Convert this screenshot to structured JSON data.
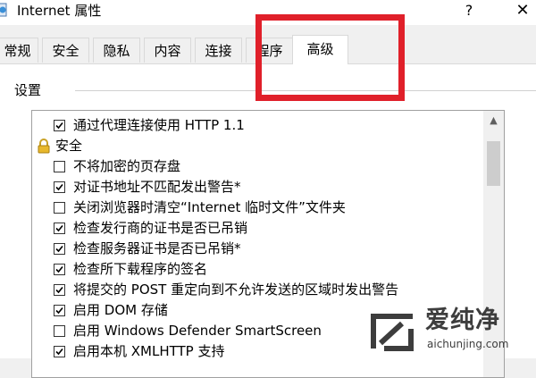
{
  "window": {
    "title": "Internet 属性",
    "help_glyph": "?",
    "close_glyph": "✕",
    "icon": "internet-options-icon"
  },
  "tabs": [
    {
      "label": "常规",
      "active": false
    },
    {
      "label": "安全",
      "active": false
    },
    {
      "label": "隐私",
      "active": false
    },
    {
      "label": "内容",
      "active": false
    },
    {
      "label": "连接",
      "active": false
    },
    {
      "label": "程序",
      "active": false
    },
    {
      "label": "高级",
      "active": true
    }
  ],
  "settings": {
    "group_label": "设置",
    "items": [
      {
        "kind": "checkbox",
        "checked": true,
        "label": "通过代理连接使用 HTTP 1.1"
      },
      {
        "kind": "category",
        "icon": "lock-icon",
        "label": "安全"
      },
      {
        "kind": "checkbox",
        "checked": false,
        "label": "不将加密的页存盘"
      },
      {
        "kind": "checkbox",
        "checked": true,
        "label": "对证书地址不匹配发出警告*"
      },
      {
        "kind": "checkbox",
        "checked": false,
        "label": "关闭浏览器时清空“Internet 临时文件”文件夹"
      },
      {
        "kind": "checkbox",
        "checked": true,
        "label": "检查发行商的证书是否已吊销"
      },
      {
        "kind": "checkbox",
        "checked": true,
        "label": "检查服务器证书是否已吊销*"
      },
      {
        "kind": "checkbox",
        "checked": true,
        "label": "检查所下载程序的签名"
      },
      {
        "kind": "checkbox",
        "checked": true,
        "label": "将提交的 POST 重定向到不允许发送的区域时发出警告"
      },
      {
        "kind": "checkbox",
        "checked": true,
        "label": "启用 DOM 存储"
      },
      {
        "kind": "checkbox",
        "checked": false,
        "label": "启用 Windows Defender SmartScreen"
      },
      {
        "kind": "checkbox",
        "checked": true,
        "label": "启用本机 XMLHTTP 支持"
      }
    ]
  },
  "annotation": {
    "color": "#e0202a"
  },
  "watermark": {
    "name": "爱纯净",
    "url": "aichunjing.com",
    "color": "#3d3d3d"
  }
}
